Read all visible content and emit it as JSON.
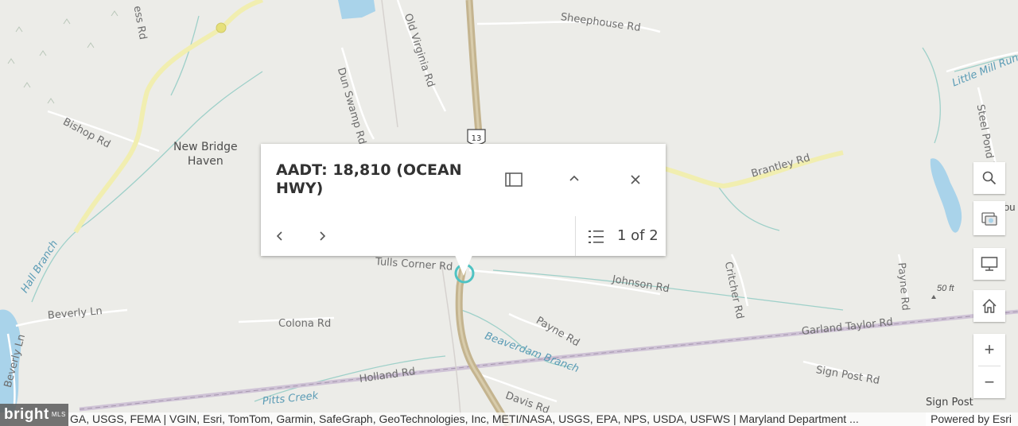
{
  "popup": {
    "title": "AADT: 18,810 (OCEAN HWY)",
    "dock_icon": "dock-icon",
    "collapse_icon": "chevron-up-icon",
    "close_icon": "close-icon",
    "prev_icon": "chevron-left-icon",
    "next_icon": "chevron-right-icon",
    "feature_menu_icon": "list-icon",
    "page_count": "1 of 2"
  },
  "map": {
    "labels": {
      "sheephouse": "Sheephouse Rd",
      "old_virginia": "Old Virginia Rd",
      "dun_swamp": "Dun Swamp Rd",
      "bishop": "Bishop Rd",
      "new_bridge_1": "New Bridge",
      "new_bridge_2": "Haven",
      "hall_branch": "Hall Branch",
      "beverly_ln": "Beverly Ln",
      "beverly_ln_v": "Beverly Ln",
      "colona": "Colona Rd",
      "tulls_corner": "Tulls Corner Rd",
      "johnson": "Johnson Rd",
      "payne": "Payne Rd",
      "beaverdam": "Beaverdam Branch",
      "holland": "Holland Rd",
      "pitts_creek": "Pitts Creek",
      "davis": "Davis Rd",
      "critcher": "Critcher Rd",
      "payne_rd_v": "Payne Rd",
      "garland_taylor": "Garland Taylor Rd",
      "sign_post": "Sign Post Rd",
      "brantley": "Brantley Rd",
      "little_mill_run": "Little Mill Run",
      "steel_pond": "Steel Pond Rd",
      "ess_rd": "ess Rd",
      "highway_shield": "13",
      "city_partial": "ou",
      "elevation": "50 ft"
    },
    "colors": {
      "background": "#ecece8",
      "highway": "#c4b48f",
      "highlight_road": "#f1eeb0",
      "water": "#a9d3ea",
      "stream": "#9ed0c9",
      "railway": "#c9b8cf",
      "road": "#ffffff"
    }
  },
  "widgets": {
    "search_icon": "search-icon",
    "basemap_icon": "basemap-gallery-icon",
    "fullscreen_icon": "monitor-icon",
    "home_icon": "home-icon",
    "zoom_in": "+",
    "zoom_out": "−"
  },
  "footer": {
    "attribution": "GA, USGS, FEMA | VGIN, Esri, TomTom, Garmin, SafeGraph, GeoTechnologies, Inc, METI/NASA, USGS, EPA, NPS, USDA, USFWS | Maryland Department ...",
    "powered_by": "Powered by Esri",
    "corner_label": "Sign Post",
    "logo_text": "bright",
    "logo_sub": "MLS"
  }
}
